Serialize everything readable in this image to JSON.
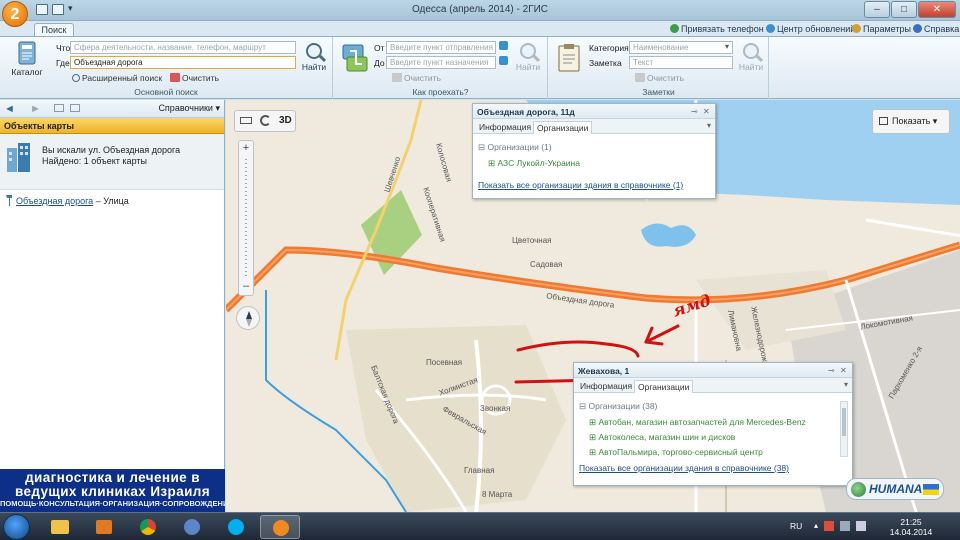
{
  "window": {
    "title": "Одесса (апрель 2014) - 2ГИС",
    "logo": "2",
    "controls": {
      "minimize": "–",
      "maximize": "□",
      "close": "✕"
    }
  },
  "ribbon": {
    "tab": "Поиск",
    "top_links": [
      "Привязать телефон",
      "Центр обновлений",
      "Параметры",
      "Справка"
    ],
    "main_search": {
      "catalog_label": "Каталог",
      "what_label": "Что",
      "what_placeholder": "Сфера деятельности, название, телефон, маршрут",
      "where_label": "Где",
      "where_value": "Объездная дорога",
      "find_label": "Найти",
      "advanced_label": "Расширенный поиск",
      "clear_label": "Очистить",
      "group_label": "Основной поиск"
    },
    "route": {
      "from_label": "От",
      "from_placeholder": "Введите пункт отправления",
      "to_label": "До",
      "to_placeholder": "Введите пункт назначения",
      "clear_label": "Очистить",
      "find_label": "Найти",
      "group_label": "Как проехать?"
    },
    "notes": {
      "category_label": "Категория",
      "category_placeholder": "Наименование",
      "note_label": "Заметка",
      "note_placeholder": "Текст",
      "clear_label": "Очистить",
      "find_label": "Найти",
      "group_label": "Заметки"
    }
  },
  "left_panel": {
    "directories_label": "Справочники",
    "header": "Объекты карты",
    "result_line1": "Вы искали ул. Объездная дорога",
    "result_line2": "Найдено: 1 объект карты",
    "street_link": "Объездная дорога",
    "street_type": "– Улица",
    "ad": {
      "line1": "диагностика и лечение в",
      "line2": "ведущих клиниках Израиля",
      "line3": "ПОМОЩЬ·КОНСУЛЬТАЦИЯ·ОРГАНИЗАЦИЯ·СОПРОВОЖДЕНИЕ"
    }
  },
  "map": {
    "mode_3d": "3D",
    "show_button": "Показать",
    "handwritten_note": "ямд",
    "brand_logo": "HUMANA",
    "streets": [
      "Шевченко",
      "Колосовая",
      "Кооперативная",
      "Цветочная",
      "Садовая",
      "Объездная дорога",
      "Посевная",
      "Холмистая",
      "Звонкая",
      "Февральская",
      "Балтская дорога",
      "Главная",
      "8 Марта",
      "Локомотивная",
      "Пархоменко 2-я",
      "Лимановна",
      "Железнодорожная"
    ],
    "popup1": {
      "title": "Объездная дорога, 11д",
      "tab_info": "Информация",
      "tab_orgs": "Организации",
      "section": "Организации (1)",
      "item": "АЗС Лукойл-Украина",
      "link": "Показать все организации здания в справочнике (1)"
    },
    "popup2": {
      "title": "Жевахова, 1",
      "tab_info": "Информация",
      "tab_orgs": "Организации",
      "section": "Организации (38)",
      "items": [
        "Автобан, магазин автозапчастей для Mercedes-Benz",
        "Автоколеса, магазин шин и дисков",
        "АвтоПальмира, торгово-сервисный центр"
      ],
      "link": "Показать все организации здания в справочнике (38)"
    }
  },
  "taskbar": {
    "lang": "RU",
    "time": "21:25",
    "date": "14.04.2014"
  },
  "colors": {
    "accent": "#e8a530",
    "road": "#f07a32",
    "water": "#3a9ee0",
    "park": "#a8d080",
    "ad_bg": "#0d2f88"
  }
}
